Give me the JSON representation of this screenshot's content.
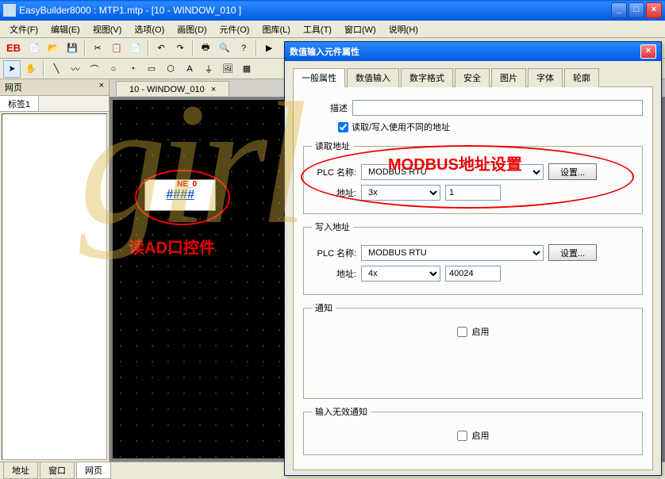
{
  "window": {
    "title": "EasyBuilder8000 : MTP1.mtp - [10 - WINDOW_010 ]"
  },
  "menus": [
    "文件(F)",
    "编辑(E)",
    "视图(V)",
    "选项(O)",
    "画图(D)",
    "元件(O)",
    "图库(L)",
    "工具(T)",
    "窗口(W)",
    "说明(H)"
  ],
  "eb_logo": "EB",
  "left": {
    "header": "网页",
    "tab": "标签1"
  },
  "doc_tab": "10 - WINDOW_010",
  "widget": {
    "label": "NE_0",
    "content": "####"
  },
  "annotation_canvas": "读AD口控件",
  "annotation_dialog": "MODBUS地址设置",
  "bottom_tabs": [
    "地址",
    "窗口",
    "网页"
  ],
  "dialog": {
    "title": "数值输入元件属性",
    "tabs": [
      "一般属性",
      "数值输入",
      "数字格式",
      "安全",
      "图片",
      "字体",
      "轮廓"
    ],
    "desc_label": "描述",
    "checkbox": "读取/写入使用不同的地址",
    "read_legend": "读取地址",
    "write_legend": "写入地址",
    "plc_label": "PLC 名称:",
    "addr_label": "地址:",
    "settings_btn": "设置...",
    "read": {
      "plc": "MODBUS RTU",
      "type": "3x",
      "num": "1"
    },
    "write": {
      "plc": "MODBUS RTU",
      "type": "4x",
      "num": "40024"
    },
    "notify_legend": "通知",
    "invalid_legend": "输入无效通知",
    "enable": "启用"
  },
  "watermark": "girl"
}
